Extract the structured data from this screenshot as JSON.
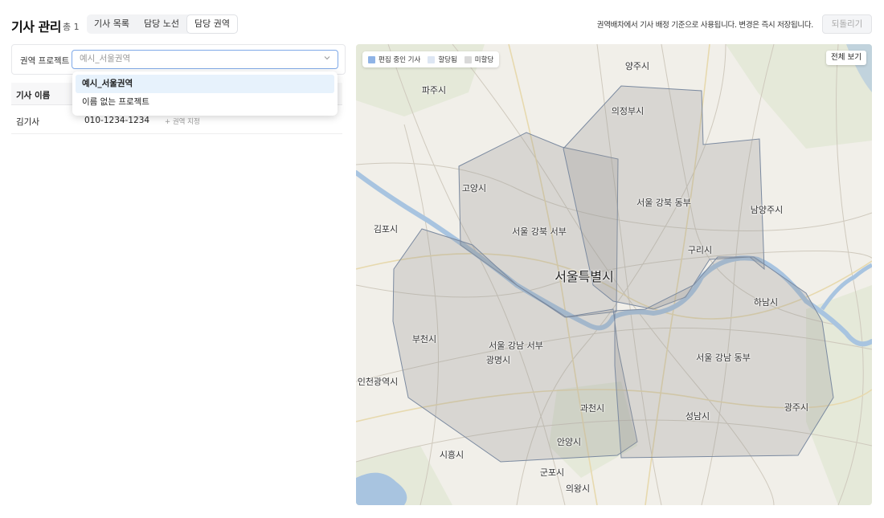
{
  "header": {
    "title": "기사 관리",
    "total": "총 1",
    "tabs": [
      {
        "label": "기사 목록"
      },
      {
        "label": "담당 노선"
      },
      {
        "label": "담당 권역"
      }
    ],
    "hint": "권역배차에서 기사 배정 기준으로 사용됩니다. 변경은 즉시 저장됩니다.",
    "revert_label": "되돌리기"
  },
  "project": {
    "label": "권역 프로젝트",
    "placeholder": "예시_서울권역",
    "options": [
      "예시_서울권역",
      "이름 없는 프로젝트"
    ]
  },
  "table": {
    "columns": [
      "기사 이름"
    ],
    "rows": [
      {
        "name": "김기사",
        "phone": "010-1234-1234",
        "assign": "+ 권역 지정"
      }
    ]
  },
  "map": {
    "legend": [
      {
        "label": "편집 중인 기사",
        "color": "#8fb3e6"
      },
      {
        "label": "할당됨",
        "color": "#dde6f3"
      },
      {
        "label": "미할당",
        "color": "#d9d9d9"
      }
    ],
    "fullview_label": "전체 보기",
    "labels": {
      "yangju": "양주시",
      "paju": "파주시",
      "uijeongbu": "의정부시",
      "goyang": "고양시",
      "gangbuk_east": "서울 강북 동부",
      "namyangju": "남양주시",
      "gimpo": "김포시",
      "gangbuk_west": "서울 강북 서부",
      "guri": "구리시",
      "seoul": "서울특별시",
      "hanam": "하남시",
      "bucheon": "부천시",
      "gangnam_west": "서울 강남 서부",
      "gwangmyeong": "광명시",
      "gangnam_east": "서울 강남 동부",
      "incheon": "인천광역시",
      "gwacheon": "과천시",
      "seongnam": "성남시",
      "gwangju": "광주시",
      "anyang": "안양시",
      "siheung": "시흥시",
      "gunpo": "군포시",
      "uiwang": "의왕시"
    }
  }
}
